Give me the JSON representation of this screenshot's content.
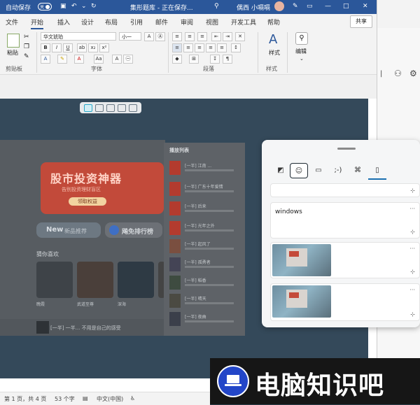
{
  "titlebar": {
    "autosave_label": "自动保存",
    "autosave_state": "关",
    "doc_title": "集形题库 - 正在保存...",
    "user_name": "偶西 小嗝嗝"
  },
  "menu": {
    "items": [
      "文件",
      "开始",
      "插入",
      "设计",
      "布局",
      "引用",
      "邮件",
      "审阅",
      "视图",
      "开发工具",
      "帮助"
    ],
    "active": "开始",
    "share_label": "共享"
  },
  "ribbon": {
    "paste_label": "粘贴",
    "clipboard_group": "剪贴板",
    "font_name": "华文琥珀",
    "font_size": "小一",
    "font_group": "字体",
    "paragraph_group": "段落",
    "styles_label": "样式",
    "styles_group": "样式",
    "edit_label": "编辑"
  },
  "statusbar": {
    "page": "第 1 页，共 4 页",
    "words": "53 个字",
    "language": "中文(中国)"
  },
  "app": {
    "banner_title": "股市投资神器",
    "banner_sub": "告别投资理财盲区",
    "banner_btn": "领取权益",
    "new_btn": "New",
    "new_sub": "新品推荐",
    "rank_btn": "飚免排行榜",
    "song_label": "猜你喜欢",
    "album_caps": [
      "晚霞",
      "武道至尊",
      "深海",
      "WW"
    ],
    "player_text": "[一半] 一半... 不用是自己的感受"
  },
  "playlist": {
    "header": "播放列表",
    "items": [
      "[一半] 江南 ...",
      "[一半] 广东十年爱情",
      "[一半] 后来",
      "[一半] 光年之外",
      "[一半] 起风了",
      "[一半] 孤勇者",
      "[一半] 稻香",
      "[一半] 晴天",
      "[一半] 夜曲"
    ]
  },
  "clipboard": {
    "text_item": "windows",
    "more_glyph": "···",
    "pin_glyph": "⊹"
  },
  "watermark": {
    "text": "电脑知识吧"
  },
  "colors": {
    "word_blue": "#2b579a",
    "clip_bg": "#f5f6f7",
    "brand_blue": "#2346c8"
  }
}
